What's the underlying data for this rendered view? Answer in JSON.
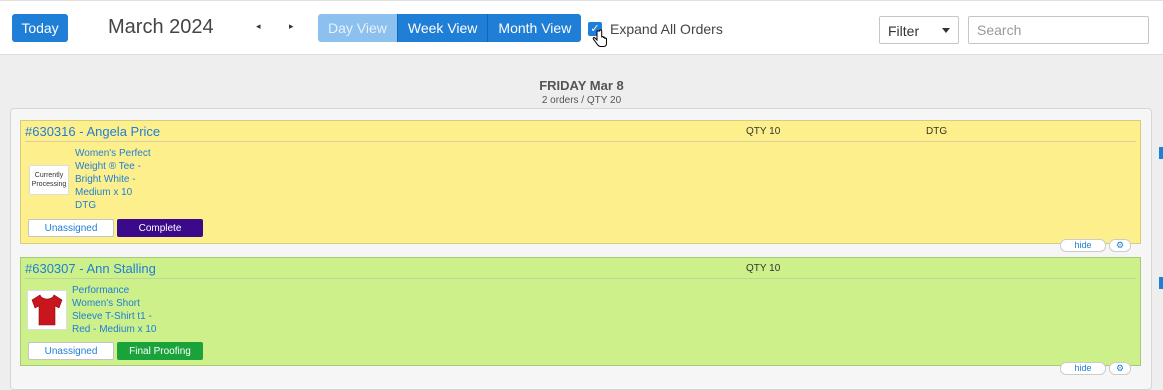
{
  "toolbar": {
    "today_label": "Today",
    "month_title": "March 2024",
    "prev_arrow": "◂",
    "next_arrow": "▸",
    "views": [
      "Day View",
      "Week View",
      "Month View"
    ],
    "expand_label": "Expand All Orders",
    "expand_checked": true,
    "filter_value": "Filter",
    "search_placeholder": "Search"
  },
  "day": {
    "title": "FRIDAY Mar 8",
    "subtitle": "2 orders / QTY 20"
  },
  "orders": [
    {
      "title": "#630316 - Angela Price",
      "qty": "QTY 10",
      "method": "DTG",
      "thumb_text": "Currently Processing",
      "item_lines": [
        "Women's Perfect",
        "Weight ® Tee -",
        "Bright White -",
        "Medium x 10",
        "DTG"
      ],
      "assign_label": "Unassigned",
      "status_label": "Complete",
      "hide_label": "hide",
      "color": "#fdf08c",
      "status_color": "#3b0a8a"
    },
    {
      "title": "#630307 - Ann Stalling",
      "qty": "QTY 10",
      "item_lines": [
        "Performance",
        "Women's Short",
        "Sleeve T-Shirt t1 -",
        "Red - Medium x 10"
      ],
      "assign_label": "Unassigned",
      "status_label": "Final Proofing",
      "hide_label": "hide",
      "color": "#cdf08a",
      "status_color": "#1aa33b"
    }
  ],
  "accent_color": "#1f7ed6"
}
